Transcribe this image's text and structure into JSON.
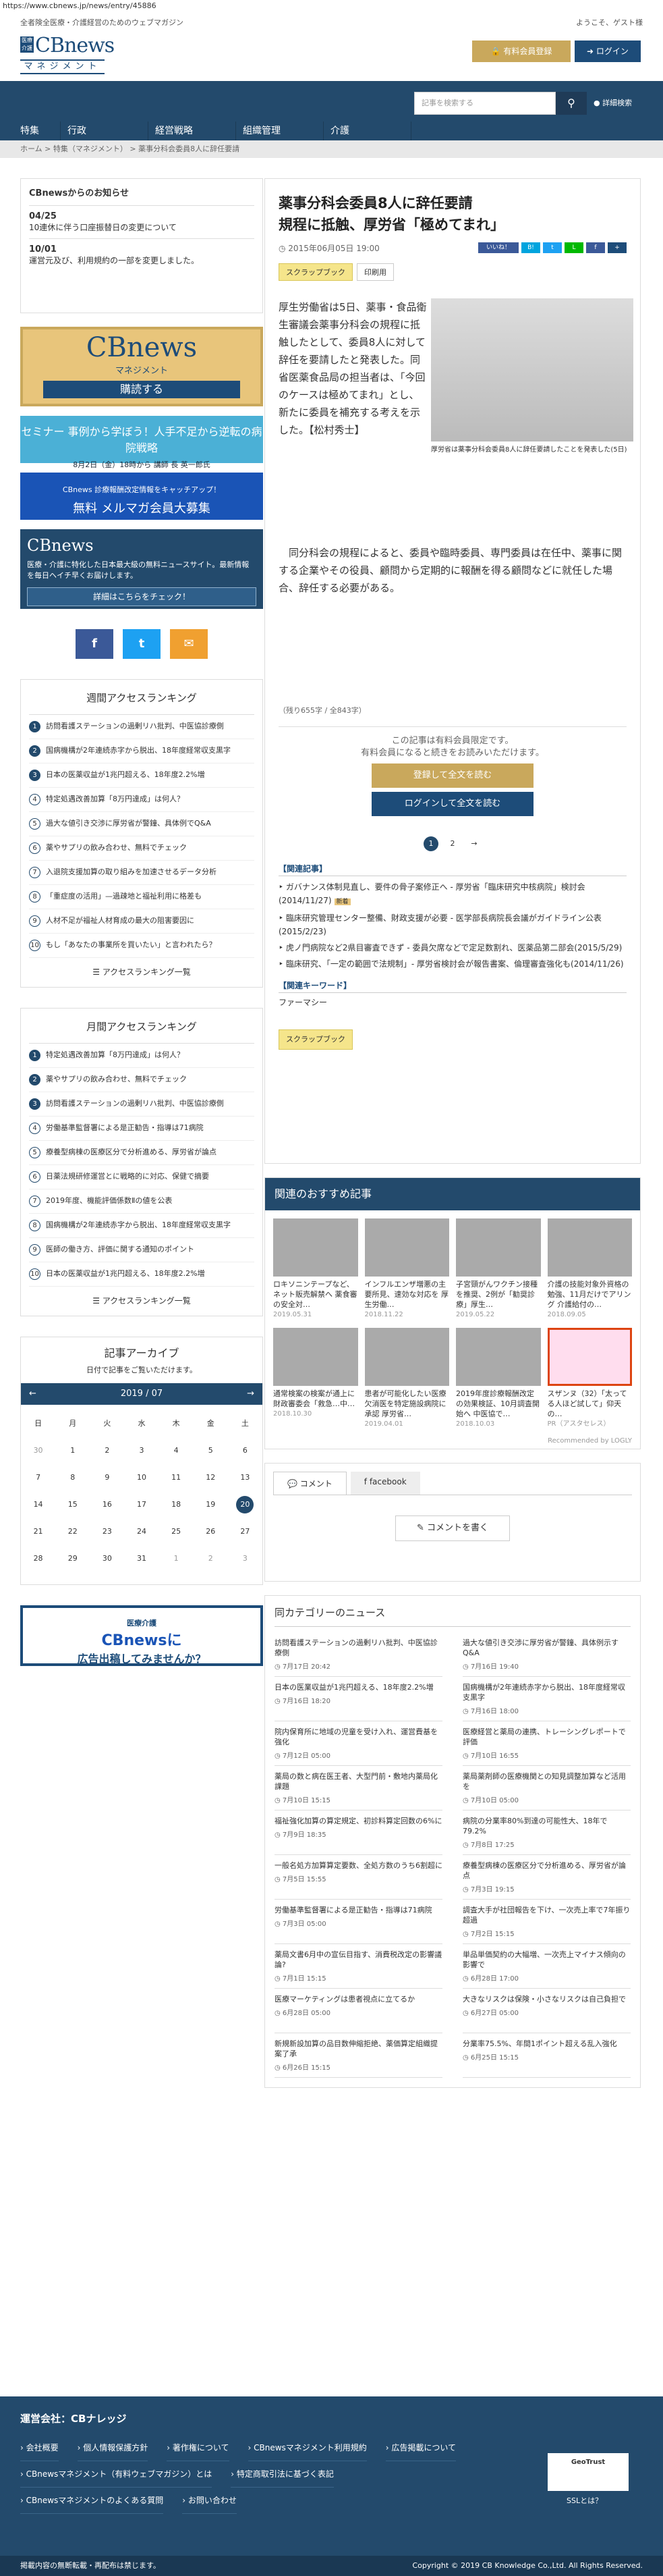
{
  "url": "https://www.cbnews.jp/news/entry/45886",
  "top": {
    "tagline": "全者険全医療・介護経営のためのウェブマガジン",
    "welcome": "ようこそ、ゲスト様"
  },
  "logo": {
    "small": "医療介護",
    "name": "CBnews",
    "sub": "マネジメント"
  },
  "header": {
    "member_button": "有料会員登録",
    "login_button": "ログイン"
  },
  "nav": {
    "search_placeholder": "記事を検索する",
    "advanced": "詳細検索",
    "menu": [
      "特集",
      "行政",
      "経営戦略",
      "組織管理",
      "介護"
    ]
  },
  "breadcrumb": "ホーム > 特集（マネジメント） > 薬事分科会委員8人に辞任要請",
  "notice": {
    "title": "CBnewsからのお知らせ",
    "items": [
      {
        "date": "04/25",
        "text": "10連休に伴う口座振替日の変更について"
      },
      {
        "date": "10/01",
        "text": "運営元及び、利用規約の一部を変更しました。"
      }
    ]
  },
  "ads": {
    "cbnews": {
      "name": "CBnews",
      "sub": "マネジメント",
      "cta": "購読する"
    },
    "seminar": {
      "title": "セミナー 事例から学ぼう！人手不足から逆転の病院戦略",
      "date": "8月2日（金）18時から 講師 長 英一郎氏"
    },
    "mail": {
      "title": "CBnews 診療報酬改定情報をキャッチアップ！",
      "sub": "無料 メルマガ会員大募集"
    },
    "info": {
      "name": "CBnews",
      "text": "医療・介護に特化した日本最大級の無料ニュースサイト。最新情報を毎日ヘイチ早くお届けします。",
      "button": "詳細はこちらをチェック！"
    }
  },
  "social": [
    {
      "name": "facebook-icon",
      "glyph": "f",
      "color": "#3b5998"
    },
    {
      "name": "twitter-icon",
      "glyph": "t",
      "color": "#1da1f2"
    },
    {
      "name": "mail-icon",
      "glyph": "✉",
      "color": "#f0a030"
    }
  ],
  "weekly": {
    "title": "週間アクセスランキング",
    "items": [
      "訪問看護ステーションの過剰リハ批判、中医協診療側",
      "国病機構が2年連続赤字から脱出、18年度経常収支黒字",
      "日本の医薬収益が1兆円超える、18年度2.2%増",
      "特定処遇改善加算「8万円達成」は何人？",
      "過大な値引き交渉に厚労省が警鐘、具体例でQ&A",
      "薬やサプリの飲み合わせ、無料でチェック",
      "入退院支援加算の取り組みを加速させるデータ分析",
      "「重症度の活用」—過疎地と福祉利用に格差も",
      "人材不足が福祉人材育成の最大の阻害要因に",
      "もし「あなたの事業所を買いたい」と言われたら？"
    ],
    "more": "アクセスランキング一覧"
  },
  "monthly": {
    "title": "月間アクセスランキング",
    "items": [
      "特定処遇改善加算「8万円達成」は何人？",
      "薬やサプリの飲み合わせ、無料でチェック",
      "訪問看護ステーションの過剰リハ批判、中医協診療側",
      "労働基準監督署による是正勧告・指導は71病院",
      "療養型病棟の医療区分で分析進める、厚労省が論点",
      "日薬法規研修運営とに戦略的に対応、保健で摘要",
      "2019年度、機能評価係数Ⅱの値を公表",
      "国病機構が2年連続赤字から脱出、18年度経常収支黒字",
      "医師の働き方、評価に関する通知のポイント",
      "日本の医薬収益が1兆円超える、18年度2.2%増"
    ],
    "more": "アクセスランキング一覧"
  },
  "archive": {
    "title": "記事アーカイブ",
    "sub": "日付で記事をご覧いただけます。",
    "month": "2019 / 07",
    "weekdays": [
      "日",
      "月",
      "火",
      "水",
      "木",
      "金",
      "土"
    ],
    "days": [
      "30",
      "1",
      "2",
      "3",
      "4",
      "5",
      "6",
      "7",
      "8",
      "9",
      "10",
      "11",
      "12",
      "13",
      "14",
      "15",
      "16",
      "17",
      "18",
      "19",
      "20",
      "21",
      "22",
      "23",
      "24",
      "25",
      "26",
      "27",
      "28",
      "29",
      "30",
      "31",
      "1",
      "2",
      "3"
    ],
    "selected": "20"
  },
  "ad_banner": {
    "text1": "医療介護",
    "text2": "CBnewsに",
    "text3": "広告出稿してみませんか？"
  },
  "article": {
    "title": "薬事分科会委員8人に辞任要請\n規程に抵触、厚労省「極めてまれ」",
    "date": "2015年06月05日 19:00",
    "share_like": "いいね！",
    "scrapbook": "スクラップブック",
    "print": "印刷用",
    "lead": "厚生労働省は5日、薬事・食品衛生審議会薬事分科会の規程に抵触したとして、委員8人に対して辞任を要請したと発表した。同省医薬食品局の担当者は、「今回のケースは極めてまれ」とし、新たに委員を補充する考えを示した。【松村秀士】",
    "caption": "厚労省は薬事分科会委員8人に辞任要請したことを発表した(5日)",
    "paragraph": "同分科会の規程によると、委員や臨時委員、専門委員は在任中、薬事に関する企業やその役員、顧問から定期的に報酬を得る顧問などに就任した場合、辞任する必要がある。",
    "char_count": "（残り655字 / 全843字）",
    "paywall_1": "この記事は有料会員限定です。",
    "paywall_2": "有料会員になると続きをお読みいただけます。",
    "register_button": "登録して全文を読む",
    "login_button": "ログインして全文を読む",
    "pages": [
      "1",
      "2",
      "→"
    ],
    "related_title": "【関連記事】",
    "related": [
      "ガバナンス体制見直し、要件の骨子案修正へ - 厚労省「臨床研究中核病院」検討会(2014/11/27)",
      "臨床研究管理センター整備、財政支援が必要 - 医学部長病院長会議がガイドライン公表(2015/2/23)",
      "虎ノ門病院など2県目審査できず - 委員欠席などで定足数割れ、医薬品第二部会(2015/5/29)",
      "臨床研究、「一定の範囲で法規制」- 厚労省検討会が報告書案、倫理審査強化も(2014/11/26)"
    ],
    "new_label": "新着",
    "keyword_title": "【関連キーワード】",
    "keyword": "ファーマシー"
  },
  "recs": {
    "title": "関連のおすすめ記事",
    "items": [
      {
        "title": "ロキソニンテープなど、ネット販売解禁へ 薬食審の安全対…",
        "date": "2019.05.31"
      },
      {
        "title": "インフルエンザ増悪の主要所見、速効な対応を 厚生労働…",
        "date": "2018.11.22"
      },
      {
        "title": "子宮頸がんワクチン接種を推奨、2例が「勧奨診療」厚生…",
        "date": "2019.05.22"
      },
      {
        "title": "介護の技能対象外資格の勉強、11月だけでアリング 介護給付の…",
        "date": "2018.09.05"
      },
      {
        "title": "通常検案の検案が通上に 財政審委会「救急…中…",
        "date": "2018.10.30"
      },
      {
        "title": "患者が可能化したい医療欠消医を特定施設病院に承認 厚労省…",
        "date": "2019.04.01"
      },
      {
        "title": "2019年度診療報酬改定の効果検証、10月調査開始へ 中医協で…",
        "date": "2018.10.03"
      },
      {
        "title": "スザンヌ（32）「太ってる人ほど試して」仰天の…",
        "date": "PR（アスタセレス）"
      }
    ],
    "footer": "Recommended by LOGLY"
  },
  "comments": {
    "tab_comment": "コメント",
    "tab_facebook": "facebook",
    "write": "コメントを書く"
  },
  "news": {
    "title": "同カテゴリーのニュース",
    "left": [
      {
        "t": "訪問看護ステーションの過剰リハ批判、中医協診療側",
        "d": "7月17日 20:42"
      },
      {
        "t": "日本の医業収益が1兆円超える、18年度2.2%増",
        "d": "7月16日 18:20"
      },
      {
        "t": "院内保育所に地域の児童を受け入れ、運営費基を強化",
        "d": "7月12日 05:00"
      },
      {
        "t": "薬局の数と病在医王者、大型門前・敷地内薬局化課題",
        "d": "7月10日 15:15"
      },
      {
        "t": "福祉強化加算の算定規定、初診料算定回数の6%に",
        "d": "7月9日 18:35"
      },
      {
        "t": "一般名処方加算算定要数、全処方数のうち6割超に",
        "d": "7月5日 15:55"
      },
      {
        "t": "労働基準監督署による是正勧告・指導は71病院",
        "d": "7月3日 05:00"
      },
      {
        "t": "薬局文書6月中の宣伝目指す、消費税改定の影響議論?",
        "d": "7月1日 15:15"
      },
      {
        "t": "医療マーケティングは患者視点に立てるか",
        "d": "6月28日 05:00"
      },
      {
        "t": "新規新設加算の品目数伸縮拒絶、薬価算定組織提案了承",
        "d": "6月26日 15:15"
      }
    ],
    "right": [
      {
        "t": "過大な値引き交渉に厚労省が警鐘、具体例示すQ&A",
        "d": "7月16日 19:40"
      },
      {
        "t": "国病機構が2年連続赤字から脱出、18年度経常収支黒字",
        "d": "7月16日 18:00"
      },
      {
        "t": "医療経営と薬局の連携、トレーシングレポートで評価",
        "d": "7月10日 16:55"
      },
      {
        "t": "薬局薬剤師の医療機関との知見調整加算など活用を",
        "d": "7月10日 05:00"
      },
      {
        "t": "病院の分業率80%到達の可能性大、18年で79.2%",
        "d": "7月8日 17:25"
      },
      {
        "t": "療養型病棟の医療区分で分析進める、厚労省が論点",
        "d": "7月3日 19:15"
      },
      {
        "t": "調査大手が社団報告を下け、一次売上率で7年振り超過",
        "d": "7月2日 15:15"
      },
      {
        "t": "単品単価契約の大幅増、一次売上マイナス傾向の影響で",
        "d": "6月28日 17:00"
      },
      {
        "t": "大きなリスクは保険・小さなリスクは自己負担で",
        "d": "6月27日 05:00"
      },
      {
        "t": "分業率75.5%、年間1ポイント超える乱入強化",
        "d": "6月25日 15:15"
      }
    ]
  },
  "footer": {
    "company": "運営会社：CBナレッジ",
    "links": [
      "会社概要",
      "個人情報保護方針",
      "著作権について",
      "CBnewsマネジメント利用規約",
      "広告掲載について",
      "CBnewsマネジメント（有料ウェブマガジン）とは",
      "特定商取引法に基づく表記",
      "CBnewsマネジメントのよくある質問",
      "お問い合わせ"
    ],
    "geotrust": "GeoTrust",
    "ssl": "SSLとは？",
    "notice": "掲載内容の無断転載・再配布は禁じます。",
    "copyright": "Copyright © 2019 CB Knowledge Co.,Ltd. All Rights Reserved."
  }
}
